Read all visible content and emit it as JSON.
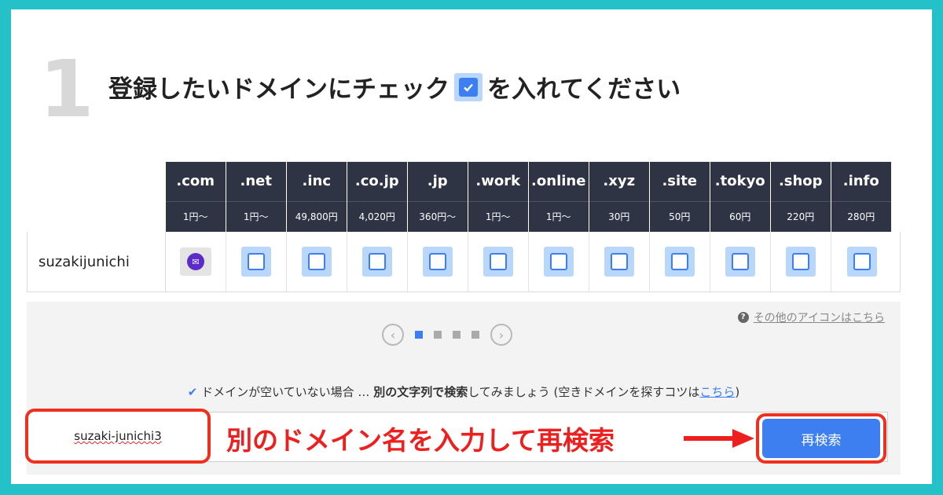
{
  "step_number": "1",
  "heading": {
    "before": "登録したいドメインにチェック",
    "after": "を入れてください"
  },
  "tlds": [
    {
      "name": ".com",
      "price": "1円〜"
    },
    {
      "name": ".net",
      "price": "1円〜"
    },
    {
      "name": ".inc",
      "price": "49,800円"
    },
    {
      "name": ".co.jp",
      "price": "4,020円"
    },
    {
      "name": ".jp",
      "price": "360円〜"
    },
    {
      "name": ".work",
      "price": "1円〜"
    },
    {
      "name": ".online",
      "price": "1円〜"
    },
    {
      "name": ".xyz",
      "price": "30円"
    },
    {
      "name": ".site",
      "price": "50円"
    },
    {
      "name": ".tokyo",
      "price": "60円"
    },
    {
      "name": ".shop",
      "price": "220円"
    },
    {
      "name": ".info",
      "price": "280円"
    }
  ],
  "domain_row": {
    "name": "suzakijunichi",
    "statuses": [
      "taken-mail-icon",
      "checkbox",
      "checkbox",
      "checkbox",
      "checkbox",
      "checkbox",
      "checkbox",
      "checkbox",
      "checkbox",
      "checkbox",
      "checkbox",
      "checkbox"
    ]
  },
  "help_link": "その他のアイコンはこちら",
  "pager": {
    "pages": 4,
    "current": 1
  },
  "hint": {
    "prefix": "ドメインが空いていない場合 … ",
    "bold": "別の文字列で検索",
    "middle": "してみましょう (空きドメインを探すコツは",
    "link": "こちら",
    "suffix": ")"
  },
  "search": {
    "value": "suzaki-junichi3",
    "button_label": "再検索"
  },
  "annotation": "別のドメイン名を入力して再検索",
  "colors": {
    "frame": "#24c1c8",
    "header_bg": "#2e3444",
    "accent_blue": "#3d7ff0",
    "annotation_red": "#ee1f1f"
  }
}
